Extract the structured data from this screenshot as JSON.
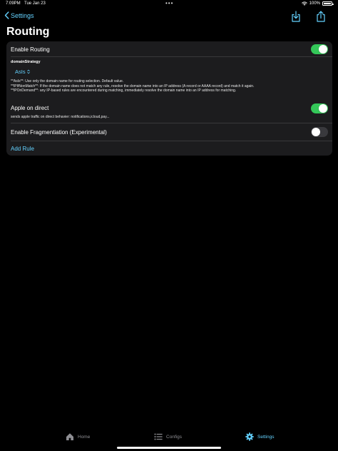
{
  "status_bar": {
    "time": "7:09PM",
    "date": "Tue Jan 23",
    "dots": "•••",
    "battery": "100%"
  },
  "nav": {
    "back_label": "Settings",
    "title": "Routing"
  },
  "settings": {
    "enable_routing": {
      "label": "Enable Routing",
      "on": true
    },
    "domain_strategy": {
      "label": "domainStrategy",
      "value": "AsIs",
      "descriptions": [
        "**AsIs**: Use only the domain name for routing selection. Default value.",
        "**IPIfNonMatch**: If the domain name does not match any rule, resolve the domain name into an IP address (A record or AAAA record) and match it again.",
        "**IPOnDemand**: any IP-based rules are encountered during matching, immediately resolve the domain name into an IP address for matching."
      ]
    },
    "apple_on_direct": {
      "label": "Apple on direct",
      "subtitle": "sends apple traffic on direct behavier: notifications,icloud,pay...",
      "on": true
    },
    "enable_fragmentation": {
      "label": "Enable Fragmentiation (Experimental)",
      "on": false
    },
    "add_rule_label": "Add Rule"
  },
  "tabs": [
    {
      "label": "Home",
      "icon": "house-icon",
      "active": false
    },
    {
      "label": "Configs",
      "icon": "list-icon",
      "active": false
    },
    {
      "label": "Settings",
      "icon": "gear-icon",
      "active": true
    }
  ],
  "colors": {
    "accent": "#64d2ff",
    "toggle_on": "#34c759",
    "card_bg": "#1c1c1e",
    "background": "#000000"
  }
}
